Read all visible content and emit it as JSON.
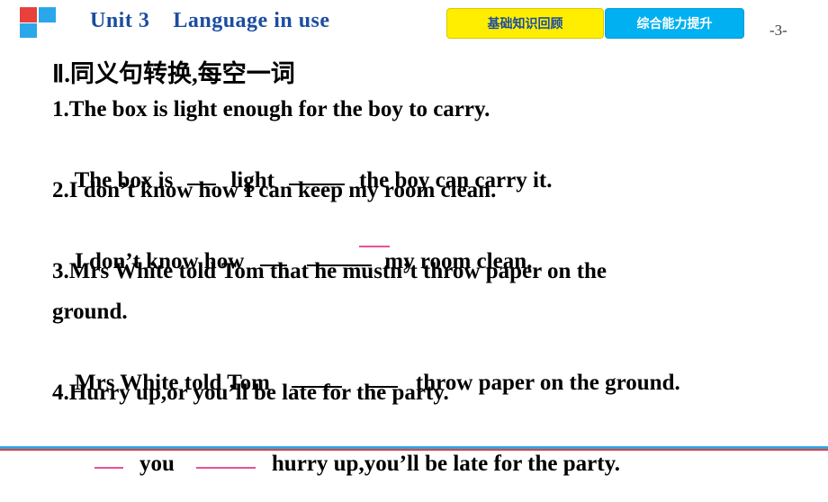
{
  "header": {
    "unit_title": "Unit 3    Language in use",
    "tab_review": "基础知识回顾",
    "tab_improve": "综合能力提升",
    "page_number": "-3-",
    "accent_blue": "#1b4da0",
    "tab_yellow_bg": "#ffee00",
    "tab_blue_bg": "#00b0f0"
  },
  "content": {
    "heading": "Ⅱ.同义句转换,每空一词",
    "items": [
      {
        "number": "1.",
        "question": "1.The box is light enough for the boy to carry.",
        "answer_pre": "The box is",
        "answer_mid": "light",
        "answer_post": "the boy can carry it."
      },
      {
        "number": "2.",
        "question": "2.I don’t know how I can keep my room clean.",
        "answer_pre": "I don’t know how",
        "answer_post": "my room clean."
      },
      {
        "number": "3.",
        "question_line1": "3.Mrs White told Tom that he mustn’t throw paper on the",
        "question_line2": "ground.",
        "answer_pre": "Mrs White told Tom",
        "answer_post": "throw paper on the ground."
      },
      {
        "number": "4.",
        "question": "4.Hurry up,or you’ll be late for the party.",
        "answer_mid": "you",
        "answer_post": "hurry up,you’ll be late for the party."
      }
    ]
  },
  "footer": {
    "line_blue": "#2aa7ea",
    "line_red": "#e8403a"
  }
}
